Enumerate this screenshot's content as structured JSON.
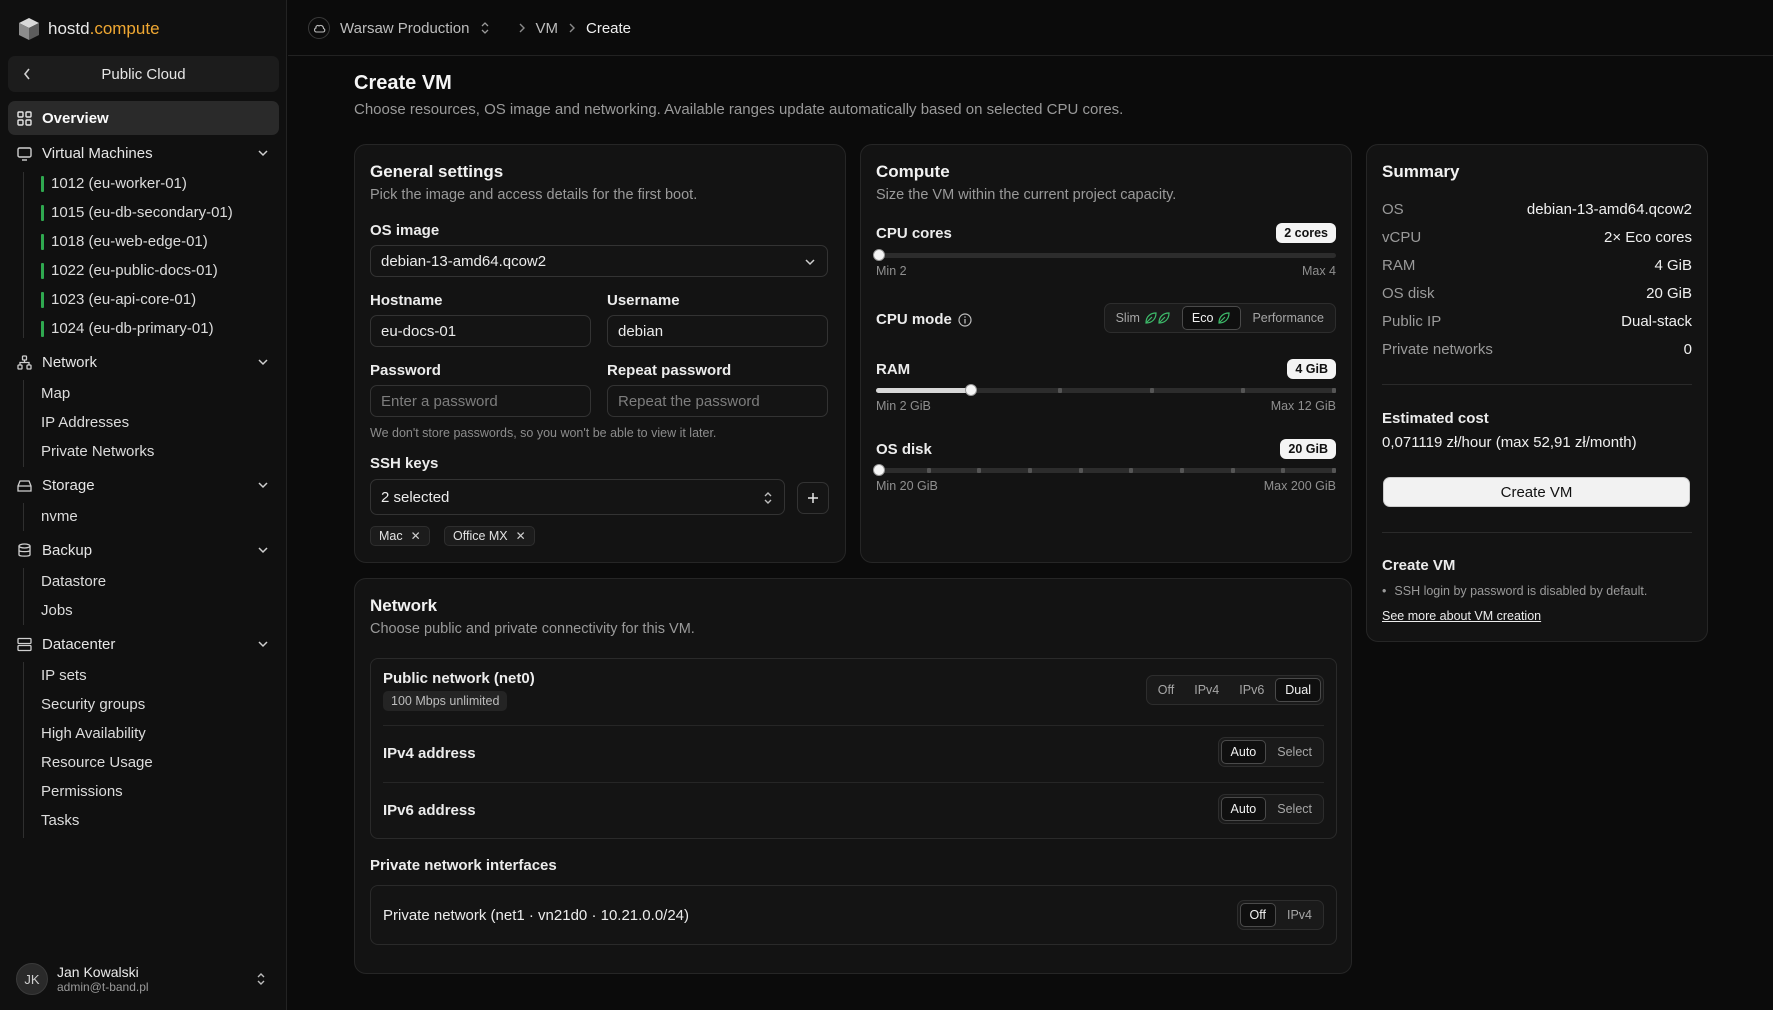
{
  "brand": {
    "name": "hostd",
    "accent": ".compute"
  },
  "sidebar": {
    "back_label": "Public Cloud",
    "overview": "Overview",
    "vm_section": "Virtual Machines",
    "vms": [
      "1012 (eu-worker-01)",
      "1015 (eu-db-secondary-01)",
      "1018 (eu-web-edge-01)",
      "1022 (eu-public-docs-01)",
      "1023 (eu-api-core-01)",
      "1024 (eu-db-primary-01)"
    ],
    "network_section": "Network",
    "network_items": [
      "Map",
      "IP Addresses",
      "Private Networks"
    ],
    "storage_section": "Storage",
    "storage_items": [
      "nvme"
    ],
    "backup_section": "Backup",
    "backup_items": [
      "Datastore",
      "Jobs"
    ],
    "datacenter_section": "Datacenter",
    "datacenter_items": [
      "IP sets",
      "Security groups",
      "High Availability",
      "Resource Usage",
      "Permissions",
      "Tasks"
    ]
  },
  "user": {
    "initials": "JK",
    "name": "Jan Kowalski",
    "email": "admin@t-band.pl"
  },
  "breadcrumb": {
    "project": "Warsaw Production",
    "section": "VM",
    "current": "Create"
  },
  "page": {
    "title": "Create VM",
    "subtitle": "Choose resources, OS image and networking. Available ranges update automatically based on selected CPU cores."
  },
  "general": {
    "title": "General settings",
    "subtitle": "Pick the image and access details for the first boot.",
    "os_label": "OS image",
    "os_value": "debian-13-amd64.qcow2",
    "hostname_label": "Hostname",
    "hostname_value": "eu-docs-01",
    "username_label": "Username",
    "username_value": "debian",
    "password_label": "Password",
    "password_placeholder": "Enter a password",
    "repeat_label": "Repeat password",
    "repeat_placeholder": "Repeat the password",
    "password_hint": "We don't store passwords, so you won't be able to view it later.",
    "ssh_label": "SSH keys",
    "ssh_value": "2 selected",
    "ssh_chips": [
      "Mac",
      "Office MX"
    ]
  },
  "compute": {
    "title": "Compute",
    "subtitle": "Size the VM within the current project capacity.",
    "cpu_label": "CPU cores",
    "cpu_badge": "2 cores",
    "cpu_min": "Min 2",
    "cpu_max": "Max 4",
    "cpu_level": 0,
    "mode_label": "CPU mode",
    "modes": [
      "Slim",
      "Eco",
      "Performance"
    ],
    "mode_selected": "Eco",
    "ram_label": "RAM",
    "ram_badge": "4 GiB",
    "ram_min": "Min 2 GiB",
    "ram_max": "Max 12 GiB",
    "ram_level": 0.2,
    "disk_label": "OS disk",
    "disk_badge": "20 GiB",
    "disk_min": "Min 20 GiB",
    "disk_max": "Max 200 GiB",
    "disk_level": 0
  },
  "summary": {
    "title": "Summary",
    "rows": [
      {
        "k": "OS",
        "v": "debian-13-amd64.qcow2"
      },
      {
        "k": "vCPU",
        "v": "2× Eco cores"
      },
      {
        "k": "RAM",
        "v": "4 GiB"
      },
      {
        "k": "OS disk",
        "v": "20 GiB"
      },
      {
        "k": "Public IP",
        "v": "Dual-stack"
      },
      {
        "k": "Private networks",
        "v": "0"
      }
    ],
    "cost_label": "Estimated cost",
    "cost_value": "0,071119 zł/hour (max 52,91 zł/month)",
    "create_button": "Create VM",
    "info_title": "Create VM",
    "info_bullet": "SSH login by password is disabled by default.",
    "info_link": "See more about VM creation"
  },
  "network": {
    "title": "Network",
    "subtitle": "Choose public and private connectivity for this VM.",
    "public_label": "Public network (net0)",
    "public_tag": "100 Mbps unlimited",
    "public_options": [
      "Off",
      "IPv4",
      "IPv6",
      "Dual"
    ],
    "public_selected": "Dual",
    "ipv4_label": "IPv4 address",
    "ipv6_label": "IPv6 address",
    "addr_options": [
      "Auto",
      "Select"
    ],
    "addr_selected": "Auto",
    "private_header": "Private network interfaces",
    "private_label": "Private network (net1 · vn21d0 · 10.21.0.0/24)",
    "private_options": [
      "Off",
      "IPv4"
    ],
    "private_selected": "Off"
  },
  "colors": {
    "brand_accent": "#f0a832",
    "vm_status": "#2fa84f",
    "eco_leaf": "#3dbb6a"
  }
}
